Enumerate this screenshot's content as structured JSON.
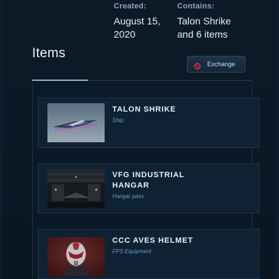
{
  "meta": {
    "created_label": "Created:",
    "created_value_line1": "August 15,",
    "created_value_line2": "2020",
    "contains_label": "Contains:",
    "contains_value_line1": "Talon Shrike",
    "contains_value_line2": "and 6 items"
  },
  "section": {
    "title": "Items",
    "exchange_label": "Exchange"
  },
  "items": [
    {
      "title_line1": "TALON SHRIKE",
      "title_line2": "",
      "subtitle": "Ship",
      "thumb": "ship-image"
    },
    {
      "title_line1": "VFG INDUSTRIAL",
      "title_line2": "HANGAR",
      "subtitle": "Hangar pass",
      "thumb": "hangar-image"
    },
    {
      "title_line1": "CCC AVES HELMET",
      "title_line2": "",
      "subtitle": "FPS Equipment",
      "thumb": "helmet-image"
    }
  ],
  "colors": {
    "accent": "#8fb1cc",
    "subtitle": "#6e9bc4",
    "exchange_icon": "#e0333a"
  },
  "icons": {
    "exchange": "no-entry-icon"
  }
}
